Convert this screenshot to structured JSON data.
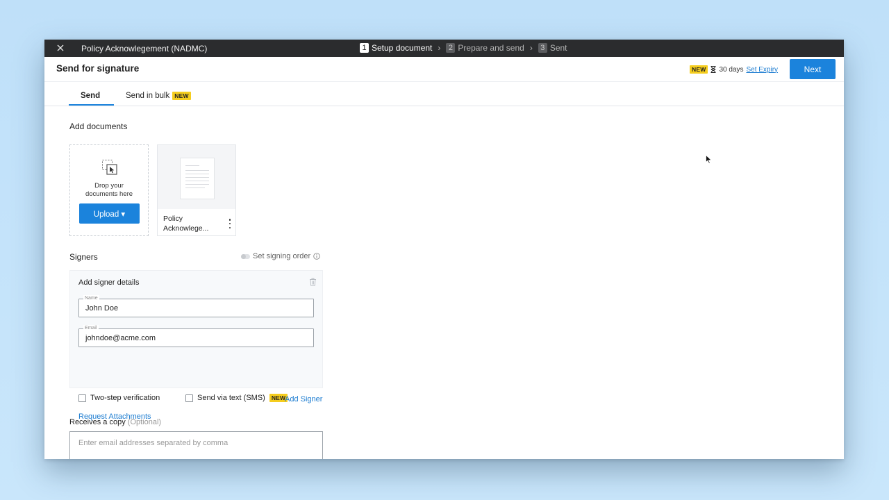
{
  "topbar": {
    "document_title": "Policy Acknowlegement (NADMC)",
    "steps": [
      {
        "number": "1",
        "label": "Setup document",
        "state": "active"
      },
      {
        "number": "2",
        "label": "Prepare and send",
        "state": "inactive"
      },
      {
        "number": "3",
        "label": "Sent",
        "state": "inactive"
      }
    ]
  },
  "header": {
    "title": "Send for signature",
    "expiry_badge": "NEW",
    "expiry_days": "30 days",
    "set_expiry_label": "Set Expiry",
    "next_label": "Next"
  },
  "tabs": [
    {
      "label": "Send",
      "active": true
    },
    {
      "label": "Send in bulk",
      "badge": "NEW"
    }
  ],
  "documents": {
    "section_title": "Add documents",
    "dropzone_text": "Drop your\ndocuments here",
    "upload_label": "Upload ▾",
    "items": [
      {
        "name": "Policy\nAcknowlege..."
      }
    ]
  },
  "signers": {
    "section_title": "Signers",
    "signing_order_label": "Set signing order",
    "card_title": "Add signer details",
    "name_legend": "Name",
    "name_value": "John Doe",
    "email_legend": "Email",
    "email_value": "johndoe@acme.com",
    "two_step_label": "Two-step verification",
    "sms_label": "Send via text (SMS)",
    "sms_badge": "NEW",
    "request_attachments_label": "Request Attachments",
    "add_signer_label": "Add Signer"
  },
  "copy": {
    "title": "Receives a copy",
    "optional": "(Optional)",
    "placeholder": "Enter email addresses separated by comma"
  },
  "colors": {
    "accent": "#1b83dc",
    "topbar": "#2b2c2e",
    "badge": "#f5cd1e"
  }
}
